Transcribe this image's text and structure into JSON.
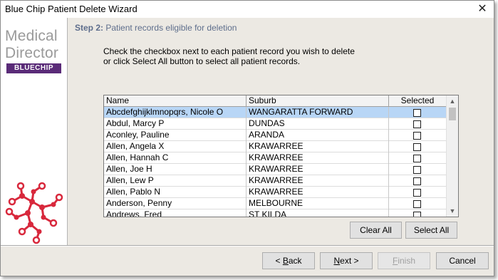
{
  "window": {
    "title": "Blue Chip Patient Delete Wizard",
    "close_symbol": "✕"
  },
  "logo": {
    "line1": "Medical",
    "line2": "Director",
    "badge": "BLUECHIP"
  },
  "step": {
    "number": "Step 2:",
    "text": "Patient records eligible for deletion"
  },
  "instructions": {
    "line1": "Check the checkbox next to each patient record you wish to delete",
    "line2": "or click Select All button to select all patient records."
  },
  "grid": {
    "columns": [
      "Name",
      "Suburb",
      "Selected"
    ],
    "rows": [
      {
        "name": "Abcdefghijklmnopqrs, Nicole O",
        "suburb": "WANGARATTA FORWARD",
        "selected": false
      },
      {
        "name": "Abdul, Marcy P",
        "suburb": "DUNDAS",
        "selected": false
      },
      {
        "name": "Aconley, Pauline",
        "suburb": "ARANDA",
        "selected": false
      },
      {
        "name": "Allen, Angela X",
        "suburb": "KRAWARREE",
        "selected": false
      },
      {
        "name": "Allen, Hannah C",
        "suburb": "KRAWARREE",
        "selected": false
      },
      {
        "name": "Allen, Joe H",
        "suburb": "KRAWARREE",
        "selected": false
      },
      {
        "name": "Allen, Lew P",
        "suburb": "KRAWARREE",
        "selected": false
      },
      {
        "name": "Allen, Pablo N",
        "suburb": "KRAWARREE",
        "selected": false
      },
      {
        "name": "Anderson, Penny",
        "suburb": "MELBOURNE",
        "selected": false
      },
      {
        "name": "Andrews, Fred",
        "suburb": "ST KILDA",
        "selected": false
      }
    ]
  },
  "buttons": {
    "clear_all": "Clear All",
    "select_all": "Select All",
    "back_prefix": "< ",
    "back_key": "B",
    "back_rest": "ack",
    "next_key": "N",
    "next_rest": "ext >",
    "finish_key": "F",
    "finish_rest": "inish",
    "cancel": "Cancel"
  },
  "colors": {
    "selected_row": "#b8d6f6",
    "logo_badge": "#5a2b78",
    "logo_molecule": "#d8283c",
    "step_text": "#5e6e8c"
  }
}
